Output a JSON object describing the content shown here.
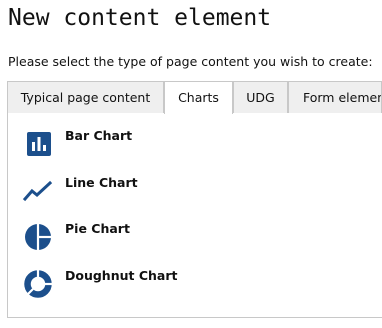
{
  "title": "New content element",
  "instruction": "Please select the type of page content you wish to create:",
  "tabs": [
    {
      "label": "Typical page content",
      "active": false
    },
    {
      "label": "Charts",
      "active": true
    },
    {
      "label": "UDG",
      "active": false
    },
    {
      "label": "Form elements",
      "active": false
    }
  ],
  "chart_items": [
    {
      "label": "Bar Chart",
      "icon": "bar-chart-icon"
    },
    {
      "label": "Line Chart",
      "icon": "line-chart-icon"
    },
    {
      "label": "Pie Chart",
      "icon": "pie-chart-icon"
    },
    {
      "label": "Doughnut Chart",
      "icon": "doughnut-chart-icon"
    }
  ],
  "colors": {
    "icon": "#1c4f8c",
    "tab_inactive_bg": "#efefef",
    "border": "#c8c8c8"
  }
}
